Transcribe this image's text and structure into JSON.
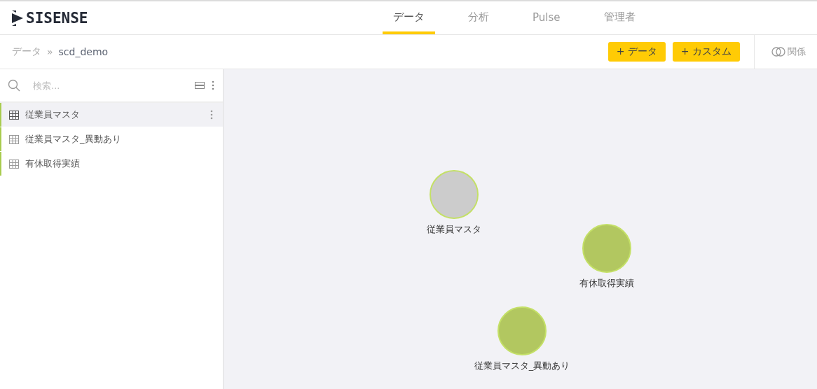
{
  "logo": {
    "text": "SISENSE"
  },
  "tabs": [
    {
      "label": "データ",
      "selected": true
    },
    {
      "label": "分析",
      "selected": false
    },
    {
      "label": "Pulse",
      "selected": false
    },
    {
      "label": "管理者",
      "selected": false
    }
  ],
  "breadcrumb": {
    "parent": "データ",
    "separator": "»",
    "current": "scd_demo"
  },
  "buttons": [
    {
      "label": "+ データ"
    },
    {
      "label": "+ カスタム"
    }
  ],
  "relations_button": {
    "label": "関係"
  },
  "search": {
    "placeholder": "検索..."
  },
  "tables": [
    {
      "name": "従業員マスタ",
      "selected": true
    },
    {
      "name": "従業員マスタ_異動あり",
      "selected": false
    },
    {
      "name": "有休取得実績",
      "selected": false
    }
  ],
  "nodes": [
    {
      "label": "従業員マスタ",
      "color": "#cccccc"
    },
    {
      "label": "有休取得実績",
      "color": "#b2c760"
    },
    {
      "label": "従業員マスタ_異動あり",
      "color": "#b2c760"
    }
  ]
}
